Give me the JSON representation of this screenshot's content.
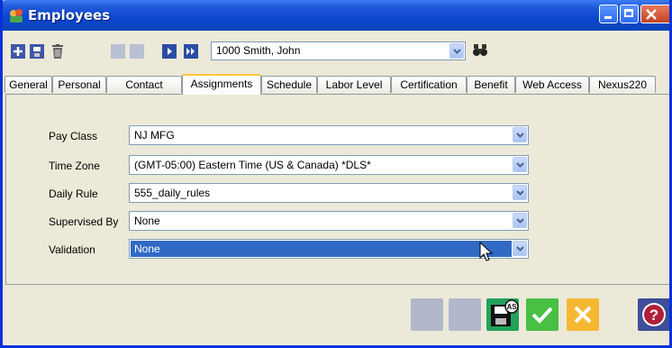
{
  "window": {
    "title": "Employees"
  },
  "toolbar": {
    "employee_value": "1000 Smith, John"
  },
  "tabs": [
    {
      "label": "General"
    },
    {
      "label": "Personal"
    },
    {
      "label": "Contact"
    },
    {
      "label": "Assignments",
      "active": true
    },
    {
      "label": "Schedule"
    },
    {
      "label": "Labor Level"
    },
    {
      "label": "Certification"
    },
    {
      "label": "Benefit"
    },
    {
      "label": "Web Access"
    },
    {
      "label": "Nexus220"
    }
  ],
  "form": {
    "pay_class": {
      "label": "Pay Class",
      "value": "NJ MFG"
    },
    "time_zone": {
      "label": "Time Zone",
      "value": "(GMT-05:00) Eastern Time (US & Canada) *DLS*"
    },
    "daily_rule": {
      "label": "Daily Rule",
      "value": "555_daily_rules"
    },
    "supervised_by": {
      "label": "Supervised By",
      "value": "None"
    },
    "validation": {
      "label": "Validation",
      "value": "None"
    }
  },
  "colors": {
    "title_bar": "#0a46d0",
    "selection": "#316ac5",
    "tab_highlight": "#ffc83c"
  }
}
